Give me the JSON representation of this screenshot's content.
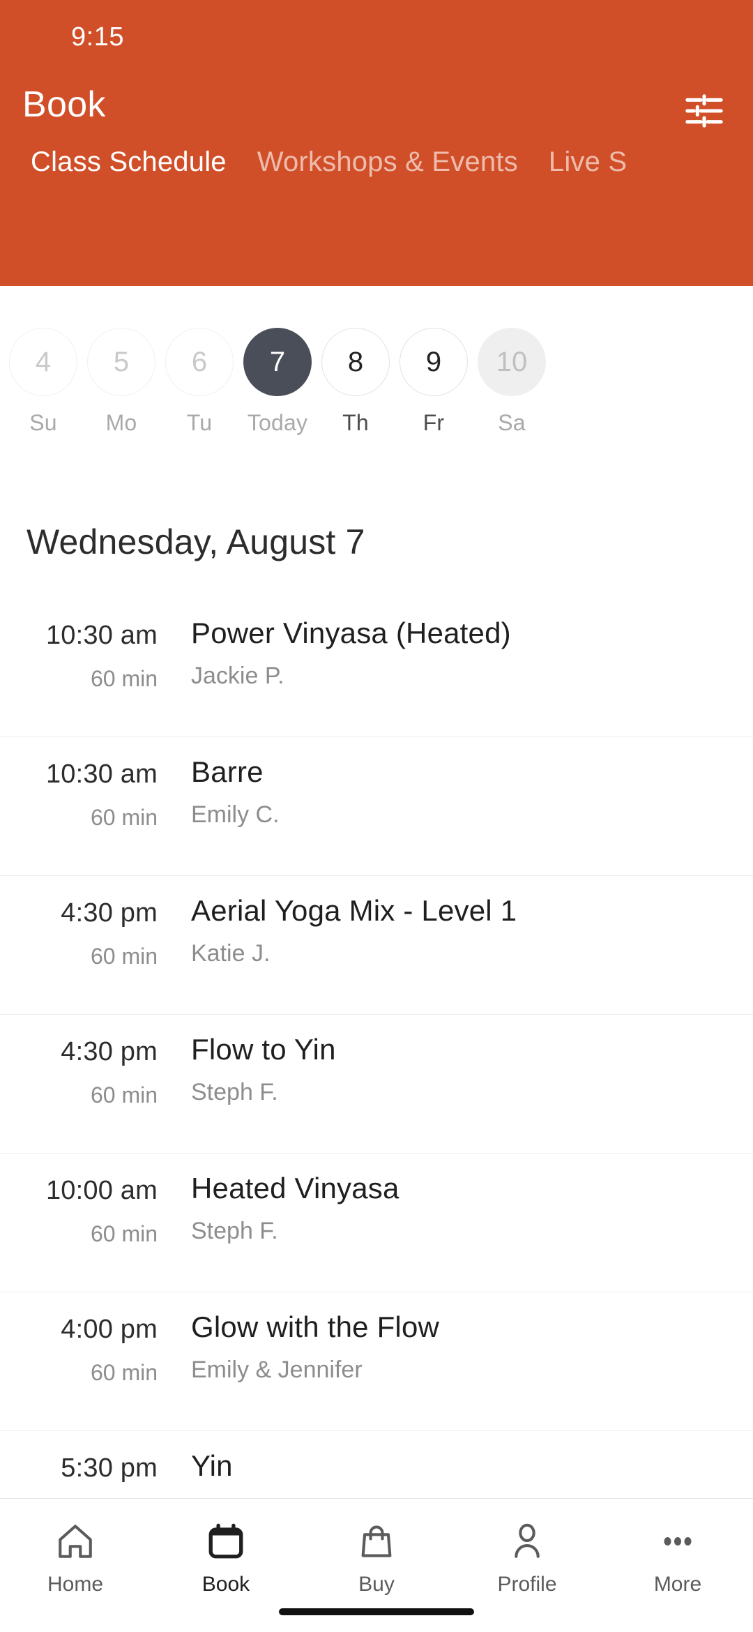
{
  "theme": {
    "accent": "#d14f28",
    "selected_day": "#4a4e58",
    "text_dark": "#1f1f1f",
    "text_muted": "#8d8d8d"
  },
  "status_bar": {
    "time": "9:15"
  },
  "header": {
    "title": "Book",
    "filter_icon": "filter-sliders-icon"
  },
  "tabs": [
    {
      "label": "Class Schedule",
      "active": true
    },
    {
      "label": "Workshops & Events",
      "active": false
    },
    {
      "label": "Live S",
      "active": false
    }
  ],
  "date_strip": [
    {
      "date": "4",
      "label": "Su",
      "state": "past"
    },
    {
      "date": "5",
      "label": "Mo",
      "state": "past"
    },
    {
      "date": "6",
      "label": "Tu",
      "state": "past"
    },
    {
      "date": "7",
      "label": "Today",
      "state": "selected"
    },
    {
      "date": "8",
      "label": "Th",
      "state": "active"
    },
    {
      "date": "9",
      "label": "Fr",
      "state": "active"
    },
    {
      "date": "10",
      "label": "Sa",
      "state": "disabled"
    }
  ],
  "schedule": {
    "date_heading": "Wednesday, August 7",
    "classes": [
      {
        "time": "10:30 am",
        "duration": "60 min",
        "name": "Power Vinyasa (Heated)",
        "teacher": "Jackie P."
      },
      {
        "time": "10:30 am",
        "duration": "60 min",
        "name": "Barre",
        "teacher": "Emily C."
      },
      {
        "time": "4:30 pm",
        "duration": "60 min",
        "name": "Aerial Yoga Mix - Level 1",
        "teacher": "Katie J."
      },
      {
        "time": "4:30 pm",
        "duration": "60 min",
        "name": "Flow to Yin",
        "teacher": "Steph F."
      },
      {
        "time": "10:00 am",
        "duration": "60 min",
        "name": "Heated Vinyasa",
        "teacher": "Steph F."
      },
      {
        "time": "4:00 pm",
        "duration": "60 min",
        "name": "Glow with the Flow",
        "teacher": "Emily & Jennifer"
      },
      {
        "time": "5:30 pm",
        "duration": "",
        "name": "Yin",
        "teacher": ""
      }
    ]
  },
  "bottom_nav": [
    {
      "label": "Home",
      "icon": "home-icon",
      "active": false
    },
    {
      "label": "Book",
      "icon": "calendar-icon",
      "active": true
    },
    {
      "label": "Buy",
      "icon": "bag-icon",
      "active": false
    },
    {
      "label": "Profile",
      "icon": "person-icon",
      "active": false
    },
    {
      "label": "More",
      "icon": "ellipsis-icon",
      "active": false
    }
  ]
}
